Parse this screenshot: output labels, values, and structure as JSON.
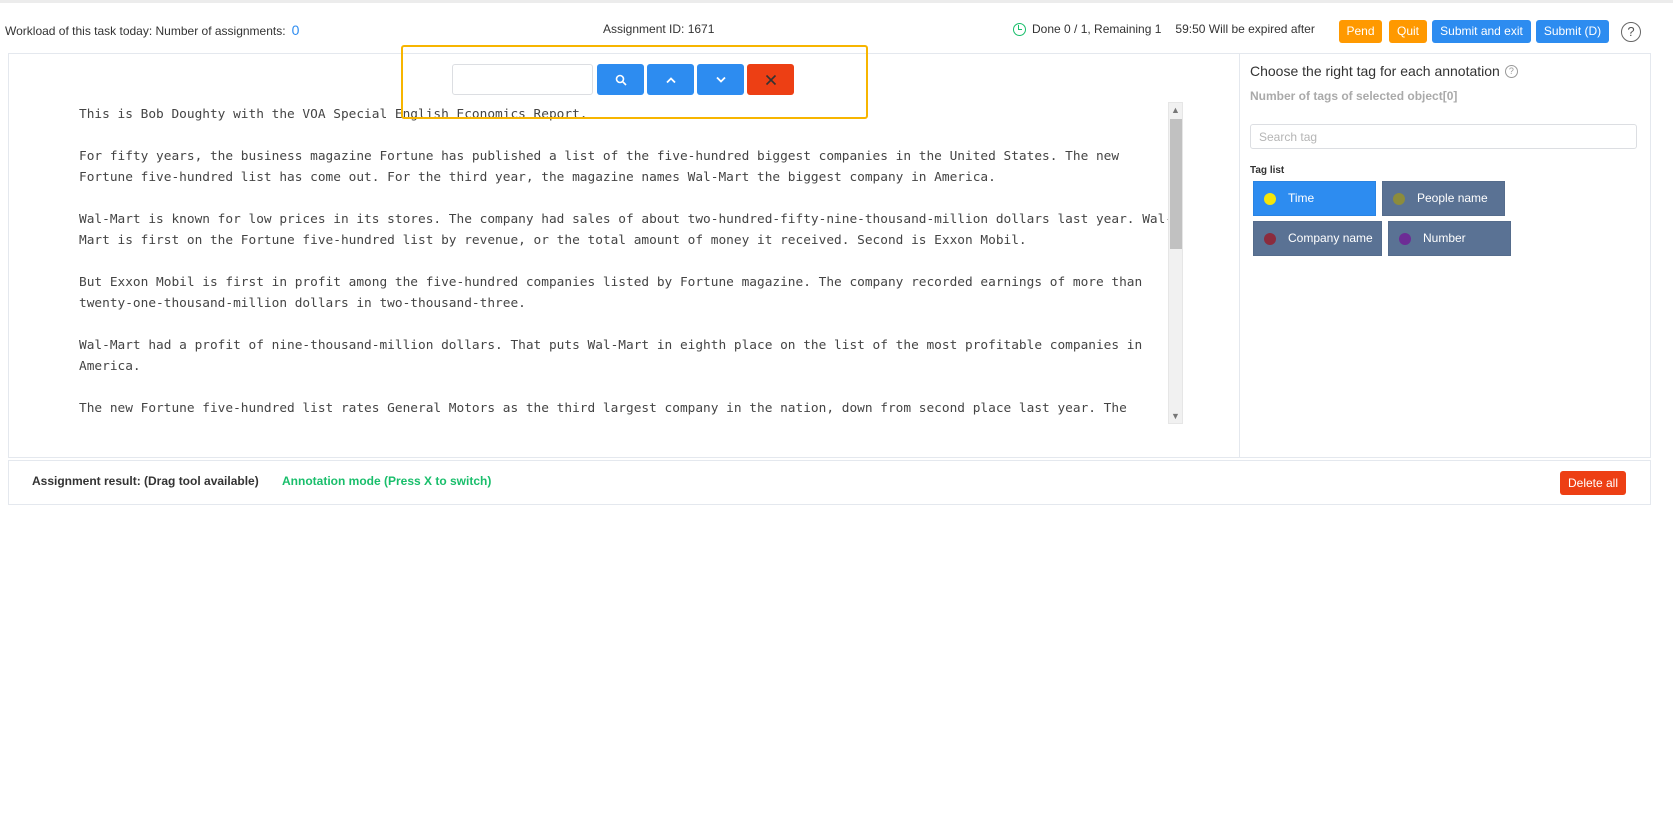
{
  "header": {
    "workload_label": "Workload of this task today: Number of assignments:",
    "workload_count": "0",
    "assignment_id": "Assignment ID: 1671",
    "progress": "Done 0 / 1, Remaining 1",
    "timer": "59:50 Will be expired after",
    "buttons": {
      "pend": "Pend",
      "quit": "Quit",
      "submit_exit": "Submit and exit",
      "submit": "Submit (D)"
    },
    "help": "?"
  },
  "search": {
    "placeholder": ""
  },
  "document": {
    "paragraphs": [
      "This is Bob Doughty with the VOA Special English Economics Report.",
      "For fifty years, the business magazine Fortune has published a list of the five-hundred biggest companies in the United States. The new Fortune five-hundred list has come out. For the third year, the magazine names Wal-Mart the biggest company in America.",
      "Wal-Mart is known for low prices in its stores. The company had sales of about two-hundred-fifty-nine-thousand-million dollars last year. Wal-Mart is first on the Fortune five-hundred list by revenue, or the total amount of money it received. Second is Exxon Mobil.",
      "But Exxon Mobil is first in profit among the five-hundred companies listed by Fortune magazine. The company recorded earnings of more than twenty-one-thousand-million dollars in two-thousand-three.",
      "Wal-Mart had a profit of nine-thousand-million dollars. That puts Wal-Mart in eighth place on the list of the most profitable companies in America.",
      "The new Fortune five-hundred list rates General Motors as the third largest company in the nation, down from second place last year. The"
    ]
  },
  "tag_panel": {
    "title": "Choose the right tag for each annotation",
    "count_label": "Number of tags of selected object[0]",
    "search_placeholder": "Search tag",
    "list_label": "Tag list",
    "tags": [
      {
        "label": "Time",
        "color": "#f5e50a",
        "active": true
      },
      {
        "label": "People name",
        "color": "#8c8c3c",
        "active": false
      },
      {
        "label": "Company name",
        "color": "#8b2c3e",
        "active": false
      },
      {
        "label": "Number",
        "color": "#6d2c95",
        "active": false
      }
    ]
  },
  "result": {
    "label": "Assignment result:  (Drag tool available)",
    "mode": "Annotation mode (Press X to switch)",
    "delete_all": "Delete all"
  },
  "colors": {
    "primary": "#2d8cf0",
    "warning": "#ff9900",
    "danger": "#ed3f14",
    "success": "#19be6b",
    "highlight_border": "#f7b500",
    "tag_inactive": "#5a7294"
  }
}
